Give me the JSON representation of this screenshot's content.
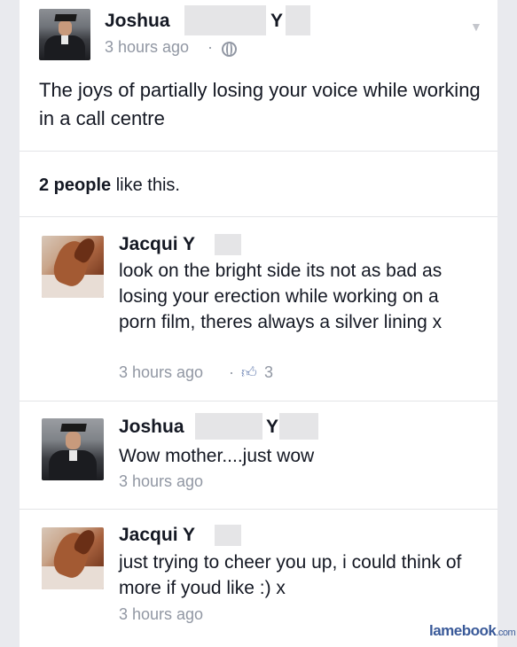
{
  "post": {
    "author_first": "Joshua",
    "author_initial": "Y",
    "time": "3 hours ago",
    "separator": "·",
    "text": "The joys of partially losing your voice while working in a call centre",
    "likes_count": "2 people",
    "likes_suffix": " like this."
  },
  "comments": [
    {
      "author": "Jacqui Y",
      "text": "look on the bright side its not as bad as losing your erection while working on a porn film, theres always a silver lining x",
      "time": "3 hours ago",
      "separator": "·",
      "likes": "3"
    },
    {
      "author_first": "Joshua",
      "author_initial": "Y",
      "text": "Wow mother....just wow",
      "time": "3 hours ago"
    },
    {
      "author": "Jacqui Y",
      "text": "just trying to cheer you up, i could think of more if youd like :) x",
      "time": "3 hours ago"
    }
  ],
  "watermark": {
    "brand": "lamebook",
    "tld": ".com"
  },
  "icons": {
    "globe": "globe-icon",
    "thumb": "thumbs-up-icon",
    "chevron": "chevron-down-icon"
  }
}
